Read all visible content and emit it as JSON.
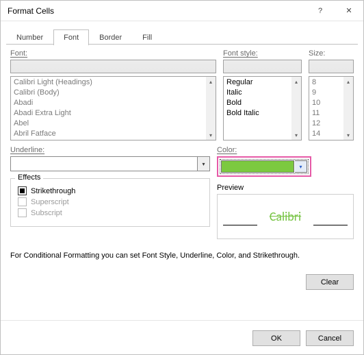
{
  "title": "Format Cells",
  "tabs": {
    "number": "Number",
    "font": "Font",
    "border": "Border",
    "fill": "Fill"
  },
  "labels": {
    "font": "Font:",
    "style": "Font style:",
    "size": "Size:",
    "underline": "Underline:",
    "color": "Color:",
    "effects": "Effects",
    "preview": "Preview"
  },
  "fontList": [
    "Calibri Light (Headings)",
    "Calibri (Body)",
    "Abadi",
    "Abadi Extra Light",
    "Abel",
    "Abril Fatface"
  ],
  "styleList": [
    "Regular",
    "Italic",
    "Bold",
    "Bold Italic"
  ],
  "sizeList": [
    "8",
    "9",
    "10",
    "11",
    "12",
    "14"
  ],
  "colorSwatch": "#7cc940",
  "effects": {
    "strike": {
      "label": "Strikethrough",
      "checked": true,
      "enabled": true
    },
    "super": {
      "label": "Superscript",
      "checked": false,
      "enabled": false
    },
    "sub": {
      "label": "Subscript",
      "checked": false,
      "enabled": false
    }
  },
  "previewText": "Calibri",
  "note": "For Conditional Formatting you can set Font Style, Underline, Color, and Strikethrough.",
  "buttons": {
    "clear": "Clear",
    "ok": "OK",
    "cancel": "Cancel"
  },
  "help": "?",
  "close": "✕"
}
